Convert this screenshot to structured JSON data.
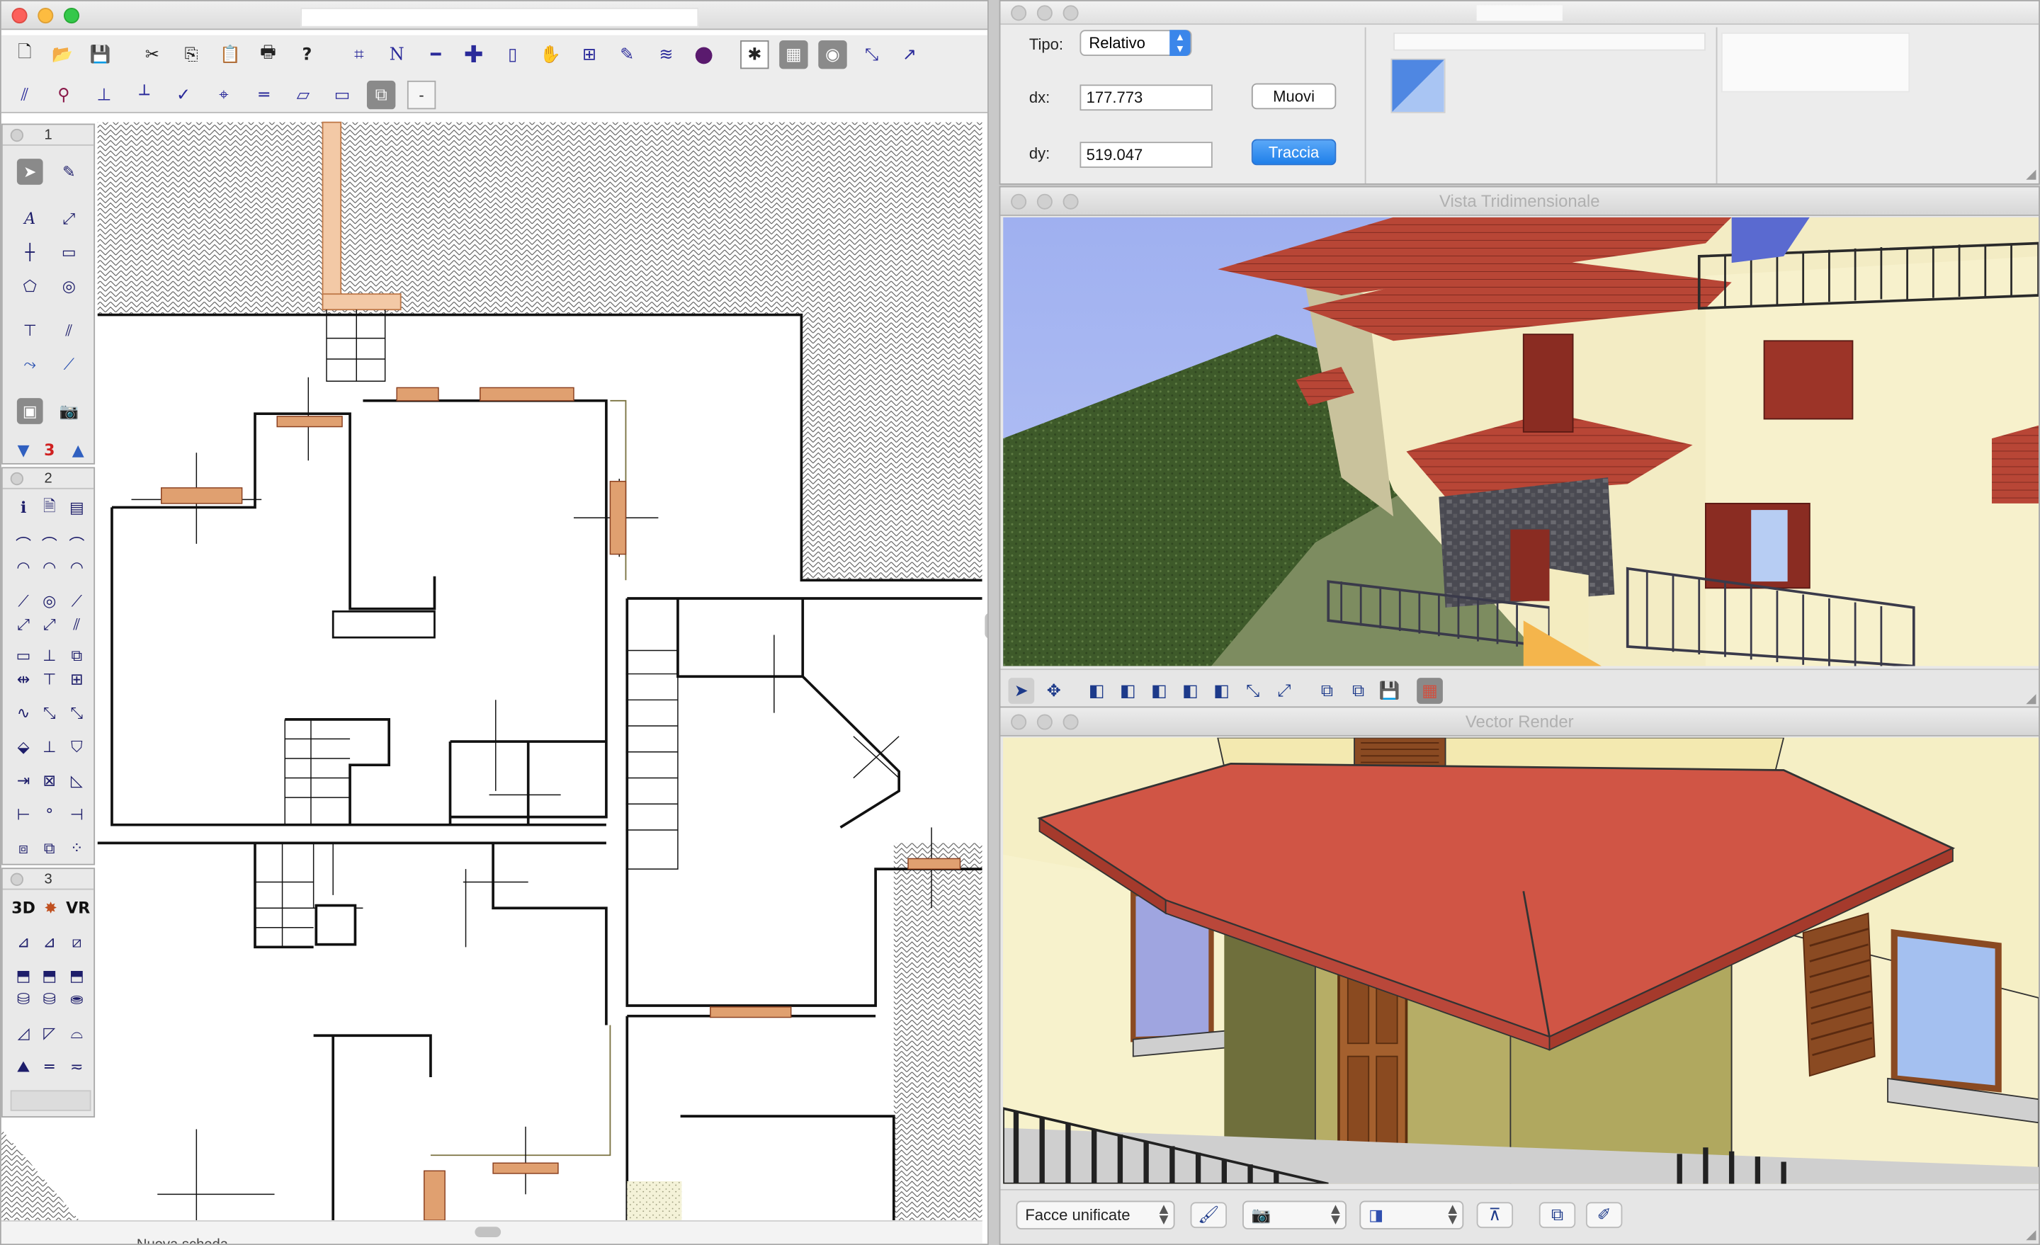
{
  "cad_window": {
    "title": "",
    "toolbar_row1": [
      "new-doc",
      "open",
      "save",
      "cut",
      "copy",
      "paste",
      "print",
      "help",
      "frame",
      "north",
      "line",
      "plus",
      "door",
      "hand",
      "flag",
      "brush",
      "ribbon",
      "circle",
      "snap",
      "grid",
      "point",
      "pick",
      "angle-arrow"
    ],
    "toolbar_row2": [
      "slash",
      "node",
      "ruler",
      "perp",
      "cross",
      "center",
      "eq",
      "parallel",
      "rect",
      "layer",
      "minus"
    ],
    "minus_label": "-",
    "palette1": {
      "label": "1",
      "counter": "3"
    },
    "palette2": {
      "label": "2"
    },
    "palette3": {
      "label": "3",
      "label_3d": "3D",
      "label_vr": "VR"
    },
    "bottom_tab_label": "Nuova scheda"
  },
  "move_panel": {
    "tipo_label": "Tipo:",
    "tipo_value": "Relativo",
    "dx_label": "dx:",
    "dx_value": "177.773",
    "dy_label": "dy:",
    "dy_value": "519.047",
    "muovi_label": "Muovi",
    "traccia_label": "Traccia"
  },
  "view3d_window": {
    "title": "Vista Tridimensionale"
  },
  "vector_window": {
    "title": "Vector Render",
    "faces_select": "Facce unificate"
  },
  "colors": {
    "accent_blue": "#1f7fe9",
    "roof_red": "#d05545",
    "wall_cream": "#f6f0c8"
  }
}
